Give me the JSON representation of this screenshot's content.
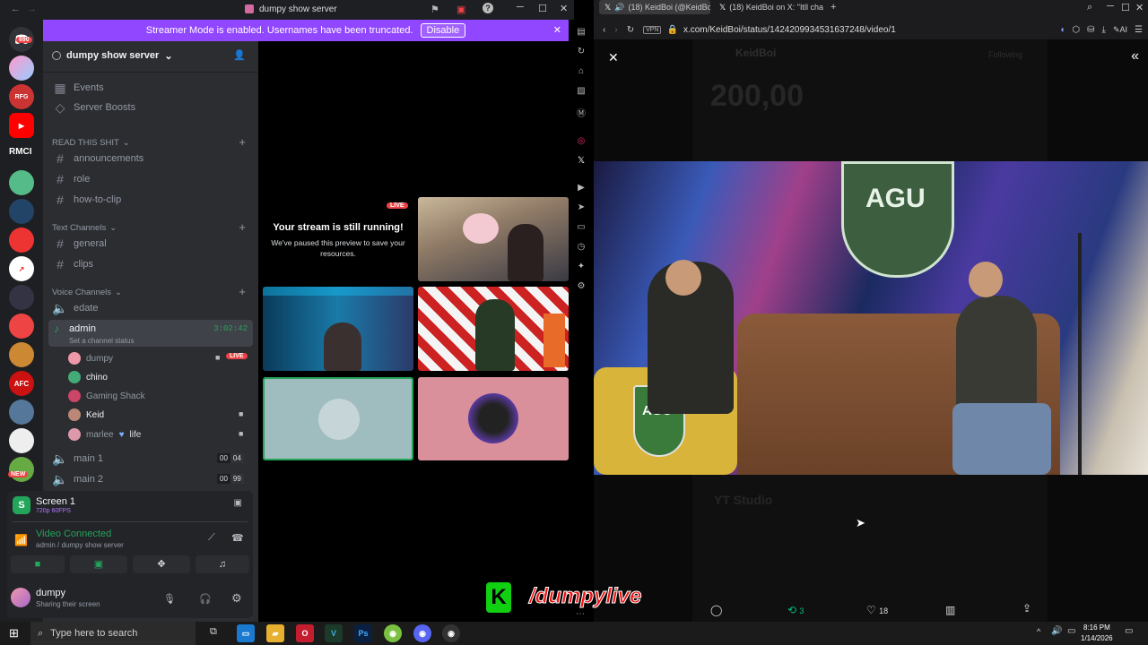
{
  "discord": {
    "window_title": "dumpy show server",
    "banner": {
      "text": "Streamer Mode is enabled. Usernames have been truncated.",
      "button": "Disable"
    },
    "server_name": "dumpy show server",
    "server_badges": {
      "mention_count": "690",
      "rmci_label": "RMCI",
      "new_label": "NEW"
    },
    "menu_items": [
      "Events",
      "Server Boosts"
    ],
    "categories": {
      "read": "READ THIS SHIT",
      "text": "Text Channels",
      "voice": "Voice Channels"
    },
    "read_channels": [
      "announcements",
      "role",
      "how-to-clip"
    ],
    "text_channels": [
      "general",
      "clips"
    ],
    "voice": {
      "edate": "edate",
      "admin": {
        "name": "admin",
        "timer": "3:02:42",
        "status": "Set a channel status"
      },
      "users": [
        {
          "name": "dumpy",
          "live": "LIVE"
        },
        {
          "name": "chino"
        },
        {
          "name": "Gaming Shack"
        },
        {
          "name": "Keid"
        },
        {
          "name": "marlee",
          "tag": "life"
        }
      ],
      "main1": {
        "name": "main 1",
        "count": "00",
        "limit": "04"
      },
      "main2": {
        "name": "main 2",
        "count": "00",
        "limit": "99"
      }
    },
    "screen": {
      "title": "Screen 1",
      "quality": "720p 60FPS"
    },
    "connection": {
      "status": "Video Connected",
      "location": "admin / dumpy show server"
    },
    "user": {
      "name": "dumpy",
      "status": "Sharing their screen"
    },
    "stream": {
      "live_badge": "LIVE",
      "title": "Your stream is still running!",
      "message": "We've paused this preview to save your resources."
    }
  },
  "browser": {
    "tabs": [
      "(18) KeidBoi (@KeidBoi",
      "(18) KeidBoi on X: \"Itll cha"
    ],
    "vpn": "VPN",
    "url": "x.com/KeidBoi/status/1424209934531637248/video/1",
    "ai": "AI",
    "actions": {
      "retweets": "3",
      "likes": "18"
    },
    "bg": {
      "profile": "KeidBoi",
      "follow": "Following",
      "number": "200,00",
      "studio": "YT Studio"
    }
  },
  "overlay": "/dumpylive",
  "taskbar": {
    "search": "Type here to search",
    "time": "8:16 PM",
    "date": "1/14/2026"
  }
}
